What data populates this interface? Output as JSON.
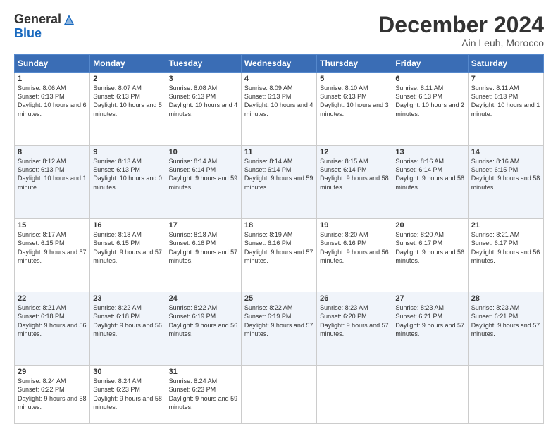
{
  "header": {
    "logo_general": "General",
    "logo_blue": "Blue",
    "title": "December 2024",
    "subtitle": "Ain Leuh, Morocco"
  },
  "days_of_week": [
    "Sunday",
    "Monday",
    "Tuesday",
    "Wednesday",
    "Thursday",
    "Friday",
    "Saturday"
  ],
  "weeks": [
    {
      "stripe": false,
      "days": [
        {
          "num": "1",
          "sunrise": "Sunrise: 8:06 AM",
          "sunset": "Sunset: 6:13 PM",
          "daylight": "Daylight: 10 hours and 6 minutes."
        },
        {
          "num": "2",
          "sunrise": "Sunrise: 8:07 AM",
          "sunset": "Sunset: 6:13 PM",
          "daylight": "Daylight: 10 hours and 5 minutes."
        },
        {
          "num": "3",
          "sunrise": "Sunrise: 8:08 AM",
          "sunset": "Sunset: 6:13 PM",
          "daylight": "Daylight: 10 hours and 4 minutes."
        },
        {
          "num": "4",
          "sunrise": "Sunrise: 8:09 AM",
          "sunset": "Sunset: 6:13 PM",
          "daylight": "Daylight: 10 hours and 4 minutes."
        },
        {
          "num": "5",
          "sunrise": "Sunrise: 8:10 AM",
          "sunset": "Sunset: 6:13 PM",
          "daylight": "Daylight: 10 hours and 3 minutes."
        },
        {
          "num": "6",
          "sunrise": "Sunrise: 8:11 AM",
          "sunset": "Sunset: 6:13 PM",
          "daylight": "Daylight: 10 hours and 2 minutes."
        },
        {
          "num": "7",
          "sunrise": "Sunrise: 8:11 AM",
          "sunset": "Sunset: 6:13 PM",
          "daylight": "Daylight: 10 hours and 1 minute."
        }
      ]
    },
    {
      "stripe": true,
      "days": [
        {
          "num": "8",
          "sunrise": "Sunrise: 8:12 AM",
          "sunset": "Sunset: 6:13 PM",
          "daylight": "Daylight: 10 hours and 1 minute."
        },
        {
          "num": "9",
          "sunrise": "Sunrise: 8:13 AM",
          "sunset": "Sunset: 6:13 PM",
          "daylight": "Daylight: 10 hours and 0 minutes."
        },
        {
          "num": "10",
          "sunrise": "Sunrise: 8:14 AM",
          "sunset": "Sunset: 6:14 PM",
          "daylight": "Daylight: 9 hours and 59 minutes."
        },
        {
          "num": "11",
          "sunrise": "Sunrise: 8:14 AM",
          "sunset": "Sunset: 6:14 PM",
          "daylight": "Daylight: 9 hours and 59 minutes."
        },
        {
          "num": "12",
          "sunrise": "Sunrise: 8:15 AM",
          "sunset": "Sunset: 6:14 PM",
          "daylight": "Daylight: 9 hours and 58 minutes."
        },
        {
          "num": "13",
          "sunrise": "Sunrise: 8:16 AM",
          "sunset": "Sunset: 6:14 PM",
          "daylight": "Daylight: 9 hours and 58 minutes."
        },
        {
          "num": "14",
          "sunrise": "Sunrise: 8:16 AM",
          "sunset": "Sunset: 6:15 PM",
          "daylight": "Daylight: 9 hours and 58 minutes."
        }
      ]
    },
    {
      "stripe": false,
      "days": [
        {
          "num": "15",
          "sunrise": "Sunrise: 8:17 AM",
          "sunset": "Sunset: 6:15 PM",
          "daylight": "Daylight: 9 hours and 57 minutes."
        },
        {
          "num": "16",
          "sunrise": "Sunrise: 8:18 AM",
          "sunset": "Sunset: 6:15 PM",
          "daylight": "Daylight: 9 hours and 57 minutes."
        },
        {
          "num": "17",
          "sunrise": "Sunrise: 8:18 AM",
          "sunset": "Sunset: 6:16 PM",
          "daylight": "Daylight: 9 hours and 57 minutes."
        },
        {
          "num": "18",
          "sunrise": "Sunrise: 8:19 AM",
          "sunset": "Sunset: 6:16 PM",
          "daylight": "Daylight: 9 hours and 57 minutes."
        },
        {
          "num": "19",
          "sunrise": "Sunrise: 8:20 AM",
          "sunset": "Sunset: 6:16 PM",
          "daylight": "Daylight: 9 hours and 56 minutes."
        },
        {
          "num": "20",
          "sunrise": "Sunrise: 8:20 AM",
          "sunset": "Sunset: 6:17 PM",
          "daylight": "Daylight: 9 hours and 56 minutes."
        },
        {
          "num": "21",
          "sunrise": "Sunrise: 8:21 AM",
          "sunset": "Sunset: 6:17 PM",
          "daylight": "Daylight: 9 hours and 56 minutes."
        }
      ]
    },
    {
      "stripe": true,
      "days": [
        {
          "num": "22",
          "sunrise": "Sunrise: 8:21 AM",
          "sunset": "Sunset: 6:18 PM",
          "daylight": "Daylight: 9 hours and 56 minutes."
        },
        {
          "num": "23",
          "sunrise": "Sunrise: 8:22 AM",
          "sunset": "Sunset: 6:18 PM",
          "daylight": "Daylight: 9 hours and 56 minutes."
        },
        {
          "num": "24",
          "sunrise": "Sunrise: 8:22 AM",
          "sunset": "Sunset: 6:19 PM",
          "daylight": "Daylight: 9 hours and 56 minutes."
        },
        {
          "num": "25",
          "sunrise": "Sunrise: 8:22 AM",
          "sunset": "Sunset: 6:19 PM",
          "daylight": "Daylight: 9 hours and 57 minutes."
        },
        {
          "num": "26",
          "sunrise": "Sunrise: 8:23 AM",
          "sunset": "Sunset: 6:20 PM",
          "daylight": "Daylight: 9 hours and 57 minutes."
        },
        {
          "num": "27",
          "sunrise": "Sunrise: 8:23 AM",
          "sunset": "Sunset: 6:21 PM",
          "daylight": "Daylight: 9 hours and 57 minutes."
        },
        {
          "num": "28",
          "sunrise": "Sunrise: 8:23 AM",
          "sunset": "Sunset: 6:21 PM",
          "daylight": "Daylight: 9 hours and 57 minutes."
        }
      ]
    },
    {
      "stripe": false,
      "days": [
        {
          "num": "29",
          "sunrise": "Sunrise: 8:24 AM",
          "sunset": "Sunset: 6:22 PM",
          "daylight": "Daylight: 9 hours and 58 minutes."
        },
        {
          "num": "30",
          "sunrise": "Sunrise: 8:24 AM",
          "sunset": "Sunset: 6:23 PM",
          "daylight": "Daylight: 9 hours and 58 minutes."
        },
        {
          "num": "31",
          "sunrise": "Sunrise: 8:24 AM",
          "sunset": "Sunset: 6:23 PM",
          "daylight": "Daylight: 9 hours and 59 minutes."
        },
        null,
        null,
        null,
        null
      ]
    }
  ]
}
